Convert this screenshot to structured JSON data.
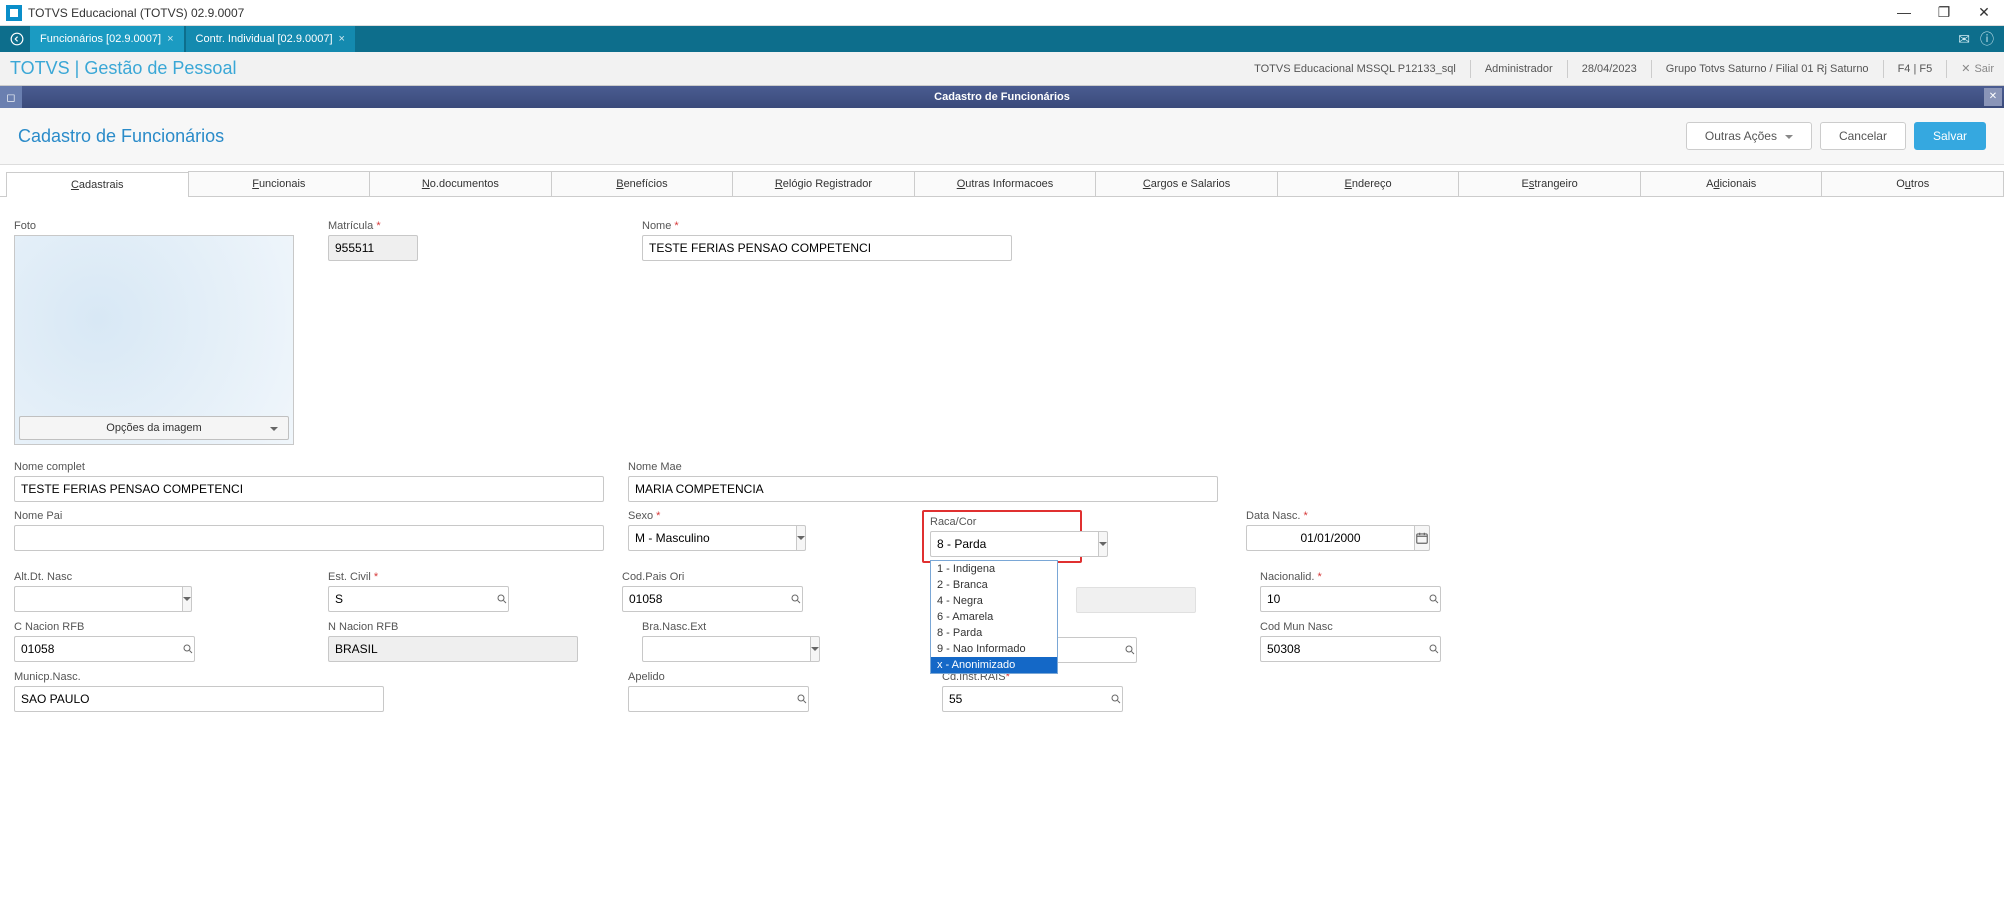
{
  "titlebar": {
    "title": "TOTVS Educacional (TOTVS) 02.9.0007"
  },
  "tabs": [
    {
      "label": "Funcionários [02.9.0007]"
    },
    {
      "label": "Contr. Individual [02.9.0007]"
    }
  ],
  "header": {
    "brand": "TOTVS | Gestão de Pessoal",
    "env": "TOTVS Educacional MSSQL P12133_sql",
    "user": "Administrador",
    "date": "28/04/2023",
    "group": "Grupo Totvs Saturno / Filial 01 Rj Saturno",
    "keys": "F4 | F5",
    "exit": "Sair"
  },
  "module": {
    "title": "Cadastro de Funcionários"
  },
  "page": {
    "title": "Cadastro de Funcionários",
    "other_actions": "Outras Ações",
    "cancel": "Cancelar",
    "save": "Salvar"
  },
  "subtabs": [
    "Cadastrais",
    "Funcionais",
    "No.documentos",
    "Benefícios",
    "Relógio Registrador",
    "Outras Informacoes",
    "Cargos e Salarios",
    "Endereço",
    "Estrangeiro",
    "Adicionais",
    "Outros"
  ],
  "fields": {
    "foto_label": "Foto",
    "foto_opts": "Opções da imagem",
    "matricula_label": "Matrícula",
    "matricula_value": "955511",
    "nome_label": "Nome",
    "nome_value": "TESTE FERIAS PENSAO COMPETENCI",
    "nome_complet_label": "Nome complet",
    "nome_complet_value": "TESTE FERIAS PENSAO COMPETENCI",
    "nome_mae_label": "Nome Mae",
    "nome_mae_value": "MARIA COMPETENCIA",
    "nome_pai_label": "Nome Pai",
    "nome_pai_value": "",
    "sexo_label": "Sexo",
    "sexo_value": "M - Masculino",
    "raca_label": "Raca/Cor",
    "raca_value": "8 - Parda",
    "raca_options": [
      "1 - Indigena",
      "2 - Branca",
      "4 - Negra",
      "6 - Amarela",
      "8 - Parda",
      "9 - Nao Informado",
      "x - Anonimizado"
    ],
    "dtnasc_label": "Data Nasc.",
    "dtnasc_value": "01/01/2000",
    "altdt_label": "Alt.Dt. Nasc",
    "estcivil_label": "Est. Civil",
    "estcivil_value": "S",
    "codpais_label": "Cod.Pais Ori",
    "codpais_value": "01058",
    "nacionalid_label": "Nacionalid.",
    "nacionalid_value": "10",
    "cnacion_label": "C Nacion RFB",
    "cnacion_value": "01058",
    "nnacion_label": "N Nacion RFB",
    "nnacion_value": "BRASIL",
    "branasc_label": "Bra.Nasc.Ext",
    "codmun_label": "Cod Mun Nasc",
    "codmun_value": "50308",
    "municp_label": "Municp.Nasc.",
    "municp_value": "SAO PAULO",
    "apelido_label": "Apelido",
    "cdinst_label": "Cd.Inst.RAIS",
    "cdinst_value": "55"
  }
}
